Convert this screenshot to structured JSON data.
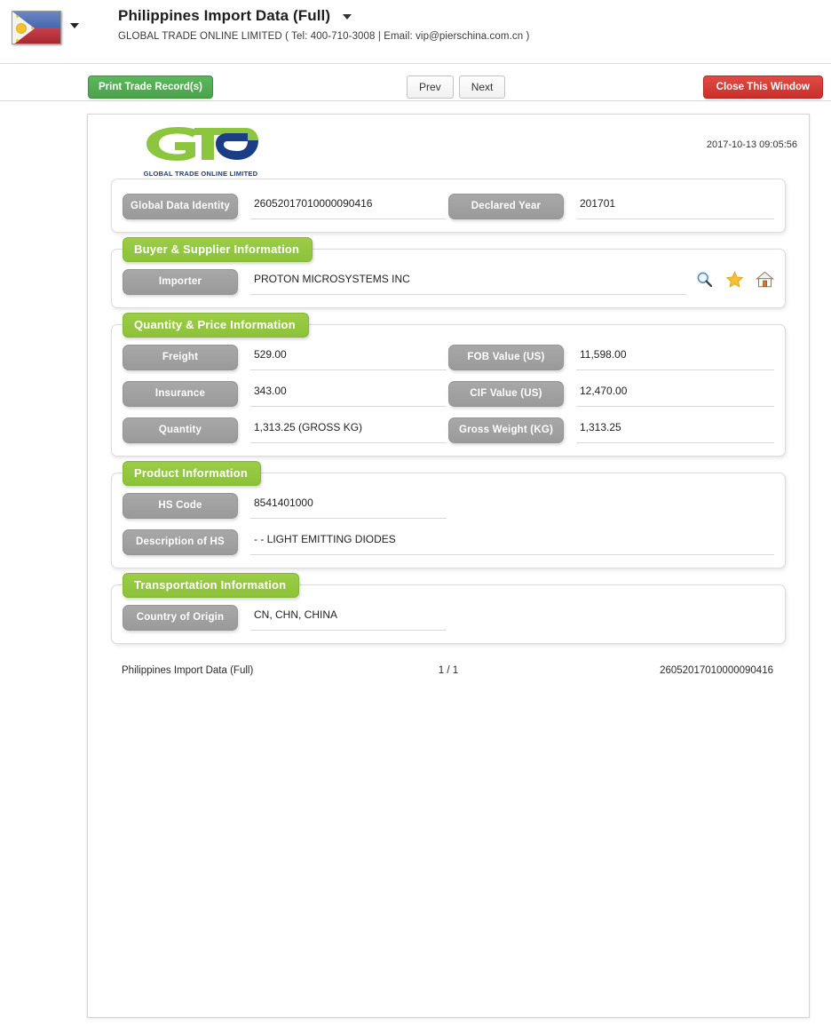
{
  "header": {
    "flag_icon": "philippines-flag-icon",
    "flag_caret_icon": "chevron-down-icon",
    "title": "Philippines Import Data (Full)",
    "title_caret_icon": "chevron-down-icon",
    "subtitle": "GLOBAL TRADE ONLINE LIMITED ( Tel: 400-710-3008 | Email: vip@pierschina.com.cn )"
  },
  "toolbar": {
    "print_label": "Print Trade Record(s)",
    "prev_label": "Prev",
    "next_label": "Next",
    "close_label": "Close This Window"
  },
  "document": {
    "logo_text": "GLOBAL TRADE  ONLINE LIMITED",
    "timestamp": "2017-10-13 09:05:56",
    "identity": {
      "global_data_identity_label": "Global Data Identity",
      "global_data_identity_value": "26052017010000090416",
      "declared_year_label": "Declared Year",
      "declared_year_value": "201701"
    },
    "sections": [
      {
        "legend": "Buyer & Supplier Information",
        "rows": [
          {
            "label": "Importer",
            "value": "PROTON MICROSYSTEMS INC"
          }
        ],
        "icons": [
          "search-icon",
          "star-icon",
          "home-icon"
        ]
      },
      {
        "legend": "Quantity & Price Information",
        "rows": [
          {
            "label": "Freight",
            "value": "529.00",
            "label2": "FOB Value (US)",
            "value2": "11,598.00"
          },
          {
            "label": "Insurance",
            "value": "343.00",
            "label2": "CIF Value (US)",
            "value2": "12,470.00"
          },
          {
            "label": "Quantity",
            "value": "1,313.25 (GROSS KG)",
            "label2": "Gross Weight (KG)",
            "value2": "1,313.25"
          }
        ]
      },
      {
        "legend": "Product Information",
        "rows": [
          {
            "label": "HS Code",
            "value": "8541401000"
          },
          {
            "label": "Description of HS",
            "value": "- - LIGHT EMITTING DIODES"
          }
        ]
      },
      {
        "legend": "Transportation Information",
        "rows": [
          {
            "label": "Country of Origin",
            "value": "CN, CHN, CHINA"
          }
        ]
      }
    ],
    "footer": {
      "left": "Philippines Import Data (Full)",
      "center": "1 / 1",
      "right": "26052017010000090416"
    }
  },
  "colors": {
    "green_accent": "#8cc23a",
    "grey_pill": "#9a9a9a",
    "print_green": "#4aa24a",
    "close_red": "#cb2f2a",
    "logo_blue": "#1b3d86"
  }
}
